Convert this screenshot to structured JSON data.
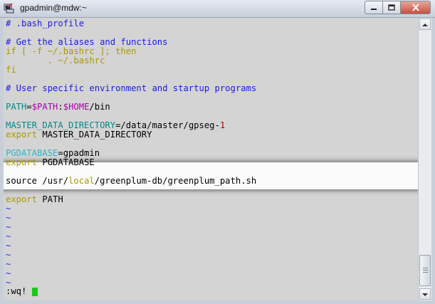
{
  "window": {
    "title": "gpadmin@mdw:~",
    "app_icon": "putty-terminal-icon",
    "buttons": [
      "minimize-icon",
      "maximize-icon",
      "close-icon"
    ]
  },
  "editor": {
    "lines": {
      "l1": "# .bash_profile",
      "l3": "# Get the aliases and functions",
      "l4_if": "if [ -f ~/.bashrc ]; then",
      "l5": "        . ~/.bashrc",
      "l6": "fi",
      "l8": "# User specific environment and startup programs",
      "l10_var": "PATH",
      "l10_eq": "=",
      "l10_path": "$PATH",
      "l10_colon": ":",
      "l10_home": "$HOME",
      "l10_rest": "/bin",
      "l12_var": "MASTER_DATA_DIRECTORY",
      "l12_val": "=/data/master/gpseg-",
      "l12_num": "1",
      "l13_kw": "export",
      "l13_rest": " MASTER_DATA_DIRECTORY",
      "l15_var": "PGDATABASE",
      "l15_val": "=gpadmin",
      "l16_kw": "export",
      "l16_rest": " PGDATABASE",
      "l18_a": "source /usr/",
      "l18_b": "local",
      "l18_c": "/greenplum-db/greenplum_path.sh",
      "l20_kw": "export",
      "l20_rest": " PATH"
    },
    "tilde": "~",
    "command": ":wq!"
  },
  "colors": {
    "terminal_bg": "#d4d4d4",
    "comment": "#1a1ae6",
    "keyword": "#a89a00",
    "variable": "#008a8a",
    "number": "#b00000",
    "cursor": "#19c819",
    "highlight_var": "#2ab5c8"
  }
}
